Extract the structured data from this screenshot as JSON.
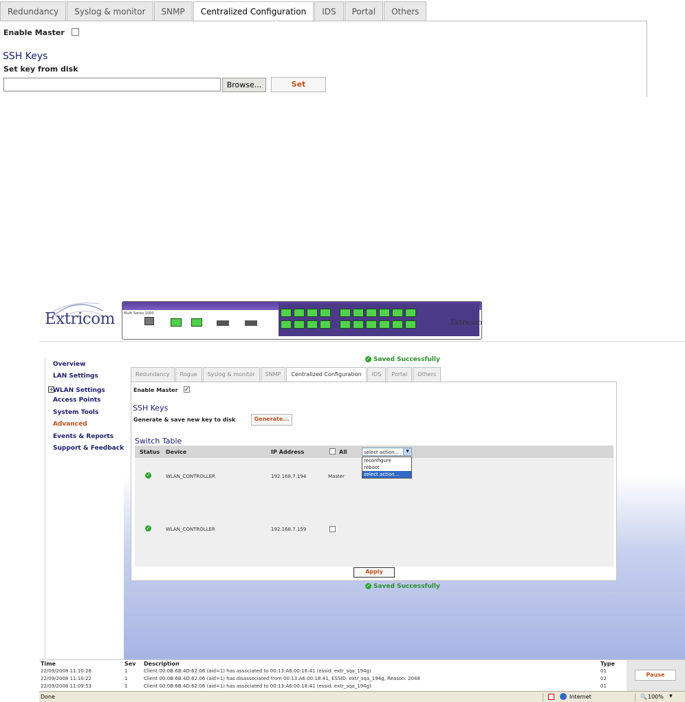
{
  "top": {
    "tabs": [
      "Redundancy",
      "Syslog & monitor",
      "SNMP",
      "Centralized Configuration",
      "IDS",
      "Portal",
      "Others"
    ],
    "active_tab": "Centralized Configuration",
    "enable_master_label": "Enable Master",
    "ssh_keys_title": "SSH Keys",
    "set_key_label": "Set key from disk",
    "browse_label": "Browse...",
    "set_label": "Set"
  },
  "bottom": {
    "logo": "Extricom",
    "device_brand": "Extricom",
    "device_model": "Multi Series 1000",
    "nav": [
      {
        "label": "Overview",
        "active": false
      },
      {
        "label": "LAN Settings",
        "active": false
      },
      {
        "label": "WLAN Settings",
        "active": false,
        "expandable": true
      },
      {
        "label": "Access Points",
        "active": false
      },
      {
        "label": "System Tools",
        "active": false
      },
      {
        "label": "Advanced",
        "active": true
      },
      {
        "label": "Events & Reports",
        "active": false
      },
      {
        "label": "Support & Feedback",
        "active": false
      }
    ],
    "saved_text": "Saved Successfully",
    "tabs": [
      "Redundancy",
      "Rogue",
      "Syslog & monitor",
      "SNMP",
      "Centralized Configuration",
      "IDS",
      "Portal",
      "Others"
    ],
    "active_tab": "Centralized Configuration",
    "enable_master_label": "Enable Master",
    "ssh_keys_title": "SSH Keys",
    "generate_label": "Generate & save new key to disk",
    "generate_button": "Generate...",
    "switch_table_title": "Switch Table",
    "columns": {
      "status": "Status",
      "device": "Device",
      "ip": "IP Address",
      "all": "All"
    },
    "select_value": "select action...",
    "select_options": [
      "reconfigure",
      "reboot",
      "select action..."
    ],
    "rows": [
      {
        "device": "WLAN_CONTROLLER",
        "ip": "192.168.7.194",
        "role": "Master"
      },
      {
        "device": "WLAN_CONTROLLER",
        "ip": "192.168.7.159",
        "role": ""
      }
    ],
    "apply_label": "Apply",
    "events": {
      "headers": {
        "time": "Time",
        "sev": "Sev",
        "desc": "Description",
        "type": "Type"
      },
      "rows": [
        {
          "time": "22/09/2008 11:10:28",
          "sev": "1",
          "desc": "Client 00:0B:6B:4D:62:06 (aid=1) has associated to 00:13:A6:00:18:41 (essid: extr_sqa_194g)",
          "type": "01"
        },
        {
          "time": "22/09/2008 11:10:22",
          "sev": "1",
          "desc": "Client 00:0B:6B:4D:62:06 (aid=1) has disassociated from 00:13:A6:00:18:41, ESSID: extr_sqa_194g, Reason: 2048",
          "type": "02"
        },
        {
          "time": "22/09/2008 11:09:53",
          "sev": "1",
          "desc": "Client 00:0B:6B:4D:62:06 (aid=1) has associated to 00:13:A6:00:18:41 (essid: extr_sqa_194g)",
          "type": "01"
        }
      ],
      "pause_label": "Pause"
    },
    "statusbar": {
      "left": "Done",
      "zone": "Internet",
      "zoom": "100%"
    }
  }
}
